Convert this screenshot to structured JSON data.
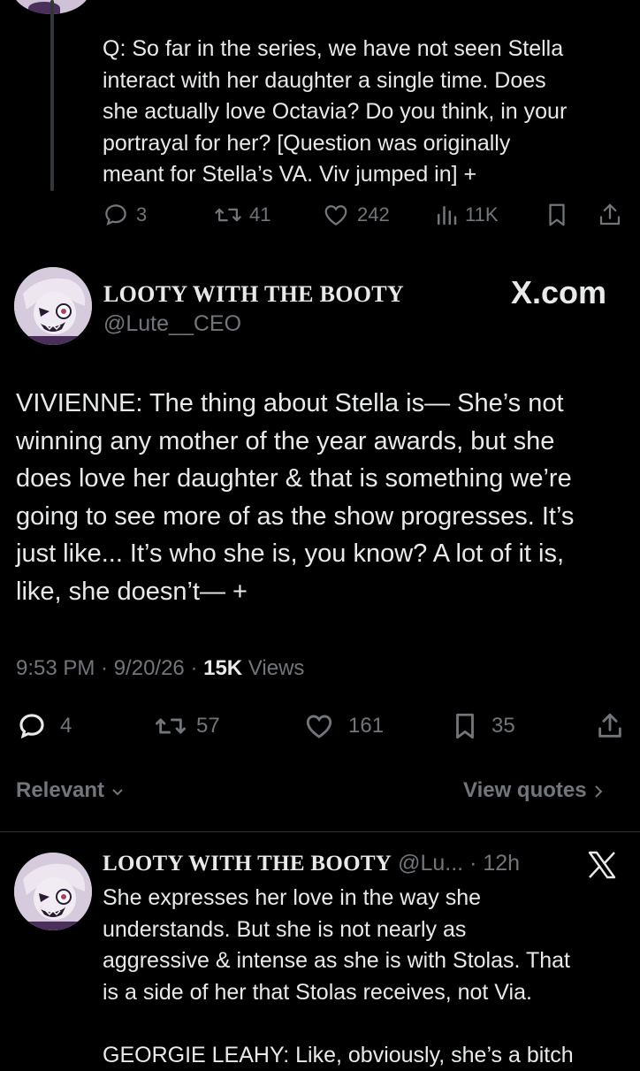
{
  "question_post": {
    "text": "Q: So far in the series, we have not seen Stella\ninteract with her daughter a single time. Does\nshe actually love Octavia? Do you think, in your\nportrayal for her? [Question was originally\nmeant for Stella’s VA. Viv jumped in] +",
    "replies": "3",
    "reposts": "41",
    "likes": "242",
    "views": "11K"
  },
  "main_post": {
    "author_name": "LOOTY WITH THE BOOTY",
    "handle": "@Lute__CEO",
    "watermark": "X.com",
    "text": "VIVIENNE: The thing about Stella is— She’s not\nwinning any mother of the year awards, but she\ndoes love her daughter & that is something we’re\ngoing to see more of as the show progresses. It’s\njust like... It’s who she is, you know? A lot of it is,\nlike, she doesn’t— +",
    "time": "9:53 PM · 9/20/26 · ",
    "views_count": "15K",
    "views_label": " Views",
    "replies": "4",
    "reposts": "57",
    "likes": "161",
    "bookmarks": "35"
  },
  "sort": {
    "relevant_label": "Relevant",
    "view_quotes_label": "View quotes"
  },
  "reply_post": {
    "author_name": "LOOTY WITH THE BOOTY",
    "handle_time": "@Lu... · 12h",
    "text": "She expresses her love in the way she\nunderstands. But she is not nearly as\naggressive & intense as she is with Stolas. That\nis a side of her that Stolas receives, not Via.\n\nGEORGIE LEAHY: Like, obviously, she’s a bitch"
  },
  "icons": [
    "reply-icon",
    "repost-icon",
    "like-icon",
    "views-icon",
    "bookmark-icon",
    "share-icon",
    "chevron-down-icon",
    "chevron-right-icon",
    "x-logo-icon"
  ]
}
